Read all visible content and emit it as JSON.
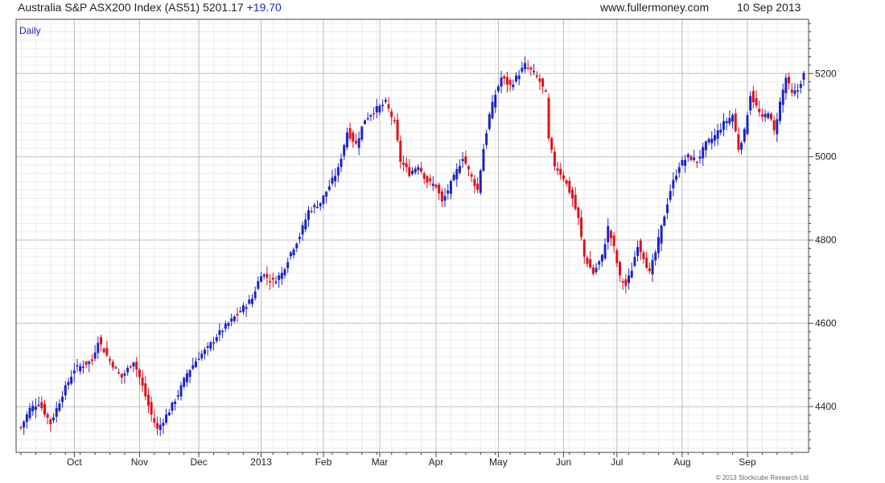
{
  "header": {
    "title": "Australia S&P ASX200 Index (AS51) 5201.17",
    "change": "+19.70",
    "site": "www.fullermoney.com",
    "date": "10 Sep 2013"
  },
  "period_label": "Daily",
  "copyright": "© 2013 Stockcube Research Ltd",
  "colors": {
    "up": "#1a24c8",
    "down": "#e0101a",
    "grid": "#d8d8d8",
    "axis": "#444444"
  },
  "chart_data": {
    "type": "candlestick",
    "ylim": [
      4290,
      5330
    ],
    "grid": true,
    "y_ticks": [
      4400,
      4600,
      4800,
      5000,
      5200
    ],
    "x_ticks": [
      {
        "label": "Oct",
        "index": 18
      },
      {
        "label": "Nov",
        "index": 40
      },
      {
        "label": "Dec",
        "index": 60
      },
      {
        "label": "2013",
        "index": 81
      },
      {
        "label": "Feb",
        "index": 102
      },
      {
        "label": "Mar",
        "index": 121
      },
      {
        "label": "Apr",
        "index": 140
      },
      {
        "label": "May",
        "index": 161
      },
      {
        "label": "Jun",
        "index": 183
      },
      {
        "label": "Jul",
        "index": 201
      },
      {
        "label": "Aug",
        "index": 223
      },
      {
        "label": "Sep",
        "index": 245
      }
    ],
    "anchors": [
      [
        0,
        4350
      ],
      [
        3,
        4395
      ],
      [
        6,
        4410
      ],
      [
        10,
        4360
      ],
      [
        14,
        4430
      ],
      [
        18,
        4490
      ],
      [
        24,
        4510
      ],
      [
        26,
        4560
      ],
      [
        30,
        4510
      ],
      [
        34,
        4470
      ],
      [
        38,
        4510
      ],
      [
        40,
        4470
      ],
      [
        44,
        4380
      ],
      [
        46,
        4345
      ],
      [
        50,
        4390
      ],
      [
        53,
        4430
      ],
      [
        56,
        4480
      ],
      [
        60,
        4520
      ],
      [
        63,
        4540
      ],
      [
        66,
        4570
      ],
      [
        70,
        4600
      ],
      [
        74,
        4630
      ],
      [
        78,
        4660
      ],
      [
        81,
        4720
      ],
      [
        85,
        4700
      ],
      [
        88,
        4720
      ],
      [
        91,
        4770
      ],
      [
        94,
        4810
      ],
      [
        97,
        4870
      ],
      [
        101,
        4890
      ],
      [
        104,
        4930
      ],
      [
        107,
        4970
      ],
      [
        110,
        5060
      ],
      [
        113,
        5030
      ],
      [
        116,
        5090
      ],
      [
        119,
        5110
      ],
      [
        121,
        5120
      ],
      [
        123,
        5130
      ],
      [
        126,
        5080
      ],
      [
        128,
        4990
      ],
      [
        131,
        4960
      ],
      [
        134,
        4980
      ],
      [
        137,
        4940
      ],
      [
        140,
        4930
      ],
      [
        142,
        4890
      ],
      [
        146,
        4950
      ],
      [
        149,
        5000
      ],
      [
        152,
        4950
      ],
      [
        154,
        4920
      ],
      [
        156,
        5020
      ],
      [
        158,
        5100
      ],
      [
        160,
        5150
      ],
      [
        162,
        5190
      ],
      [
        165,
        5170
      ],
      [
        168,
        5200
      ],
      [
        170,
        5220
      ],
      [
        173,
        5200
      ],
      [
        175,
        5180
      ],
      [
        177,
        5150
      ],
      [
        178,
        5040
      ],
      [
        180,
        4980
      ],
      [
        183,
        4950
      ],
      [
        186,
        4900
      ],
      [
        188,
        4850
      ],
      [
        190,
        4760
      ],
      [
        193,
        4720
      ],
      [
        196,
        4760
      ],
      [
        198,
        4830
      ],
      [
        200,
        4780
      ],
      [
        202,
        4710
      ],
      [
        204,
        4690
      ],
      [
        206,
        4730
      ],
      [
        208,
        4790
      ],
      [
        210,
        4760
      ],
      [
        212,
        4720
      ],
      [
        214,
        4770
      ],
      [
        216,
        4830
      ],
      [
        219,
        4920
      ],
      [
        222,
        4980
      ],
      [
        225,
        5000
      ],
      [
        228,
        4990
      ],
      [
        231,
        5030
      ],
      [
        234,
        5050
      ],
      [
        237,
        5080
      ],
      [
        240,
        5100
      ],
      [
        242,
        5020
      ],
      [
        244,
        5060
      ],
      [
        246,
        5150
      ],
      [
        248,
        5120
      ],
      [
        250,
        5090
      ],
      [
        252,
        5110
      ],
      [
        254,
        5060
      ],
      [
        256,
        5130
      ],
      [
        258,
        5190
      ],
      [
        260,
        5150
      ],
      [
        262,
        5160
      ],
      [
        264,
        5201
      ]
    ]
  }
}
